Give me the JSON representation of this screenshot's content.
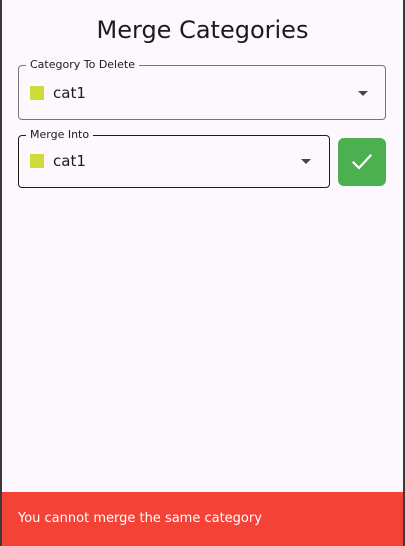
{
  "screen": {
    "title": "Merge Categories"
  },
  "delete_field": {
    "label": "Category To Delete",
    "value": "cat1",
    "swatch_color": "#cddc39",
    "dropdown_icon": "arrow-drop-down-icon"
  },
  "merge_field": {
    "label": "Merge Into",
    "value": "cat1",
    "swatch_color": "#cddc39",
    "dropdown_icon": "arrow-drop-down-icon"
  },
  "confirm_button": {
    "icon": "check-icon",
    "color": "#4caf50"
  },
  "snackbar": {
    "message": "You cannot merge the same category",
    "color": "#f44336"
  }
}
